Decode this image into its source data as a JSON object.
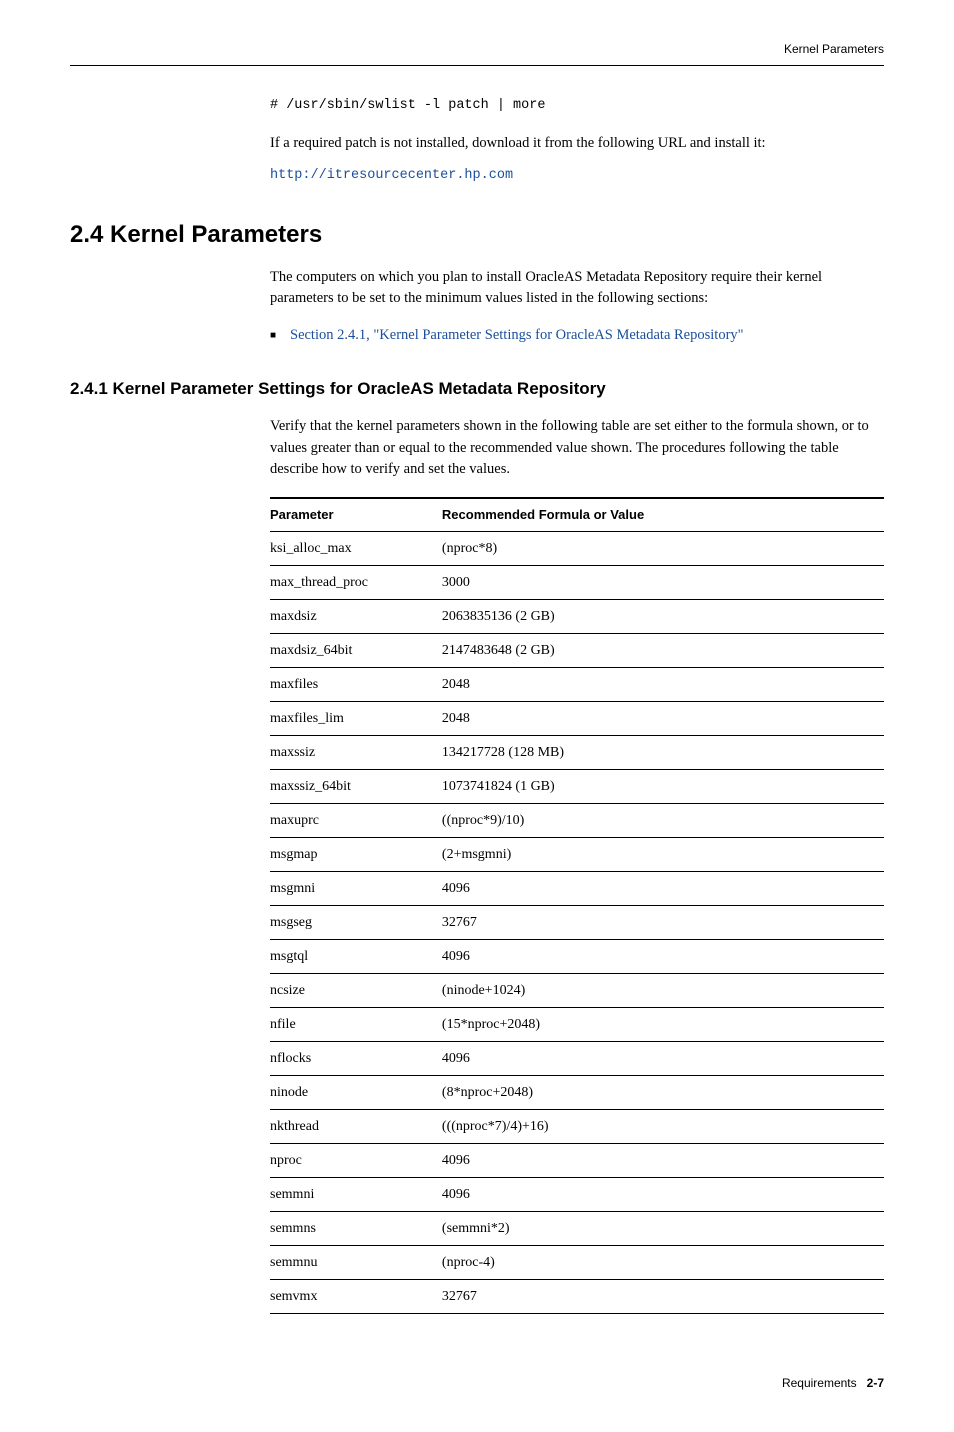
{
  "running_head": "Kernel Parameters",
  "intro": {
    "command": "# /usr/sbin/swlist -l patch | more",
    "patch_text": "If a required patch is not installed, download it from the following URL and install it:",
    "url": "http://itresourcecenter.hp.com"
  },
  "section": {
    "number": "2.4",
    "title": "Kernel Parameters",
    "para": "The computers on which you plan to install OracleAS Metadata Repository require their kernel parameters to be set to the minimum values listed in the following sections:",
    "xref": "Section 2.4.1, \"Kernel Parameter Settings for OracleAS Metadata Repository\""
  },
  "subsection": {
    "number": "2.4.1",
    "title": "Kernel Parameter Settings for OracleAS Metadata Repository",
    "para": "Verify that the kernel parameters shown in the following table are set either to the formula shown, or to values greater than or equal to the recommended value shown. The procedures following the table describe how to verify and set the values."
  },
  "table": {
    "headers": {
      "col1": "Parameter",
      "col2": "Recommended Formula or Value"
    },
    "rows": [
      {
        "p": "ksi_alloc_max",
        "v": "(nproc*8)"
      },
      {
        "p": "max_thread_proc",
        "v": "3000"
      },
      {
        "p": "maxdsiz",
        "v": "2063835136 (2 GB)"
      },
      {
        "p": "maxdsiz_64bit",
        "v": "2147483648 (2 GB)"
      },
      {
        "p": "maxfiles",
        "v": "2048"
      },
      {
        "p": "maxfiles_lim",
        "v": "2048"
      },
      {
        "p": "maxssiz",
        "v": "134217728 (128 MB)"
      },
      {
        "p": "maxssiz_64bit",
        "v": "1073741824 (1 GB)"
      },
      {
        "p": "maxuprc",
        "v": "((nproc*9)/10)"
      },
      {
        "p": "msgmap",
        "v": "(2+msgmni)"
      },
      {
        "p": "msgmni",
        "v": "4096"
      },
      {
        "p": "msgseg",
        "v": "32767"
      },
      {
        "p": "msgtql",
        "v": "4096"
      },
      {
        "p": "ncsize",
        "v": "(ninode+1024)"
      },
      {
        "p": "nfile",
        "v": "(15*nproc+2048)"
      },
      {
        "p": "nflocks",
        "v": "4096"
      },
      {
        "p": "ninode",
        "v": "(8*nproc+2048)"
      },
      {
        "p": "nkthread",
        "v": "(((nproc*7)/4)+16)"
      },
      {
        "p": "nproc",
        "v": "4096"
      },
      {
        "p": "semmni",
        "v": "4096"
      },
      {
        "p": "semmns",
        "v": "(semmni*2)"
      },
      {
        "p": "semmnu",
        "v": "(nproc-4)"
      },
      {
        "p": "semvmx",
        "v": "32767"
      }
    ]
  },
  "footer": {
    "chapter": "Requirements",
    "page": "2-7"
  }
}
